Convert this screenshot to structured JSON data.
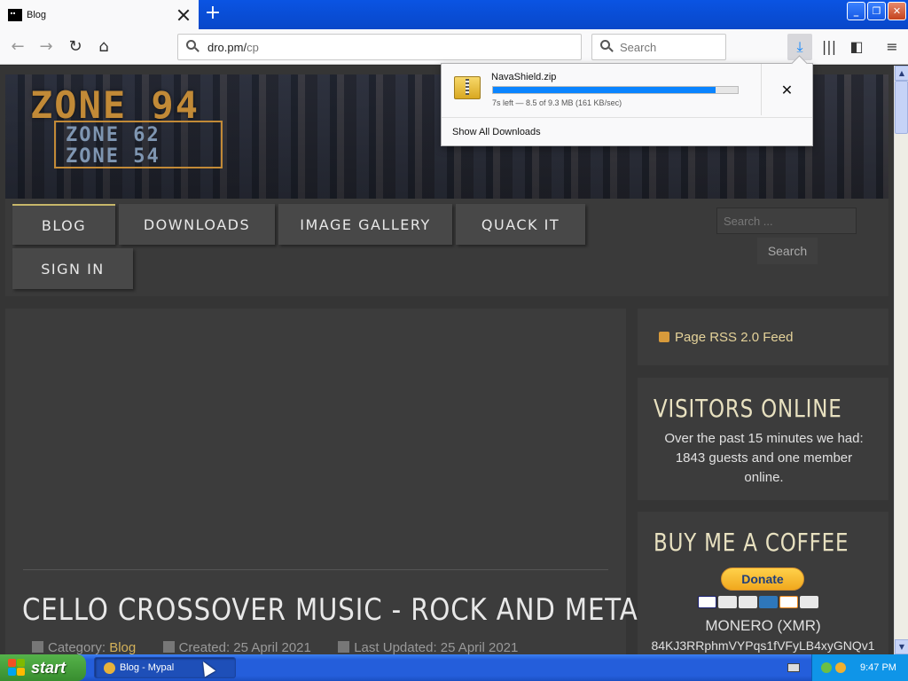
{
  "browser": {
    "tab_title": "Blog",
    "new_tab_symbol": "+",
    "url_host": "dro.pm/",
    "url_path": "cp",
    "search_placeholder": "Search"
  },
  "download_panel": {
    "file_name": "NavaShield.zip",
    "progress_fraction": 0.91,
    "status": "7s left — 8.5 of 9.3 MB (161 KB/sec)",
    "show_all_label": "Show All Downloads",
    "cancel_symbol": "✕"
  },
  "site": {
    "logo_main": "ZONE 94",
    "logo_sub1": "ZONE 62",
    "logo_sub2": "ZONE 54",
    "menu": {
      "blog": "BLOG",
      "downloads": "DOWNLOADS",
      "gallery": "IMAGE GALLERY",
      "quack": "QUACK IT",
      "signin": "SIGN IN"
    },
    "search_placeholder": "Search ...",
    "search_button": "Search"
  },
  "article": {
    "title": "CELLO CROSSOVER MUSIC - ROCK AND METAL",
    "category_label": "Category:",
    "category_value": "Blog",
    "created": "Created: 25 April 2021",
    "updated": "Last Updated: 25 April 2021"
  },
  "sidebar": {
    "rss": "Page RSS 2.0 Feed",
    "visitors_heading": "VISITORS ONLINE",
    "visitors_text": "Over the past 15 minutes we had: 1843 guests and one member online.",
    "coffee_heading": "BUY ME A COFFEE",
    "donate_label": "Donate",
    "monero_label": "MONERO (XMR)",
    "xmr_address": "84KJ3RRphmVYPqs1fVFyLB4xyGNQv1"
  },
  "taskbar": {
    "start_label": "start",
    "task_label": "Blog - Mypal",
    "clock": "9:47 PM"
  },
  "colors": {
    "xp_blue": "#245edb",
    "download_accent": "#0a84ff",
    "site_gold": "#d4b25a"
  }
}
